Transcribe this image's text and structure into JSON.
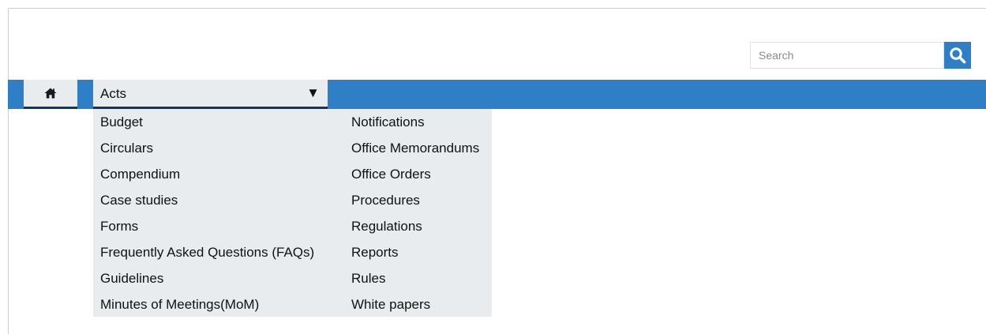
{
  "search": {
    "placeholder": "Search"
  },
  "nav": {
    "home_icon": "home-icon",
    "active_tab_label": "Acts",
    "caret": "▼"
  },
  "dropdown": {
    "left": [
      "Budget",
      "Circulars",
      "Compendium",
      "Case studies",
      "Forms",
      "Frequently Asked Questions (FAQs)",
      "Guidelines",
      "Minutes of Meetings(MoM)"
    ],
    "right": [
      "Notifications",
      "Office Memorandums",
      "Office Orders",
      "Procedures",
      "Regulations",
      "Reports",
      "Rules",
      "White papers"
    ]
  },
  "colors": {
    "navbar": "#2f7fc6",
    "tab_bg": "#e9ecee",
    "tab_underline": "#10385f"
  }
}
